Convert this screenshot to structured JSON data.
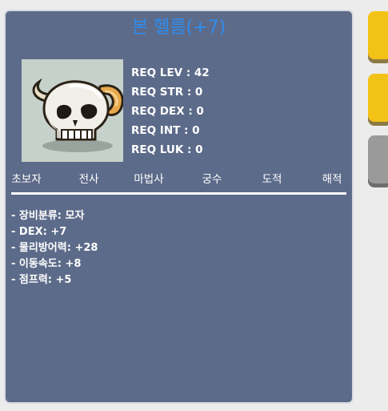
{
  "item": {
    "name": "본 헬름(+7)",
    "icon": "bone-helm-skull-icon",
    "title_color": "#2e8df0"
  },
  "requirements": [
    "REQ LEV : 42",
    "REQ STR : 0",
    "REQ DEX : 0",
    "REQ INT : 0",
    "REQ LUK : 0"
  ],
  "jobs": [
    "초보자",
    "전사",
    "마법사",
    "궁수",
    "도적",
    "해적"
  ],
  "stats": [
    "- 장비분류: 모자",
    "- DEX: +7",
    "- 물리방어력: +28",
    "- 이동속도: +8",
    "- 점프력: +5"
  ],
  "colors": {
    "panel_bg": "#5d6b8a",
    "icon_bg": "#c7d1cb",
    "button_yellow": "#f3c216",
    "button_gray": "#9a9a9a"
  }
}
